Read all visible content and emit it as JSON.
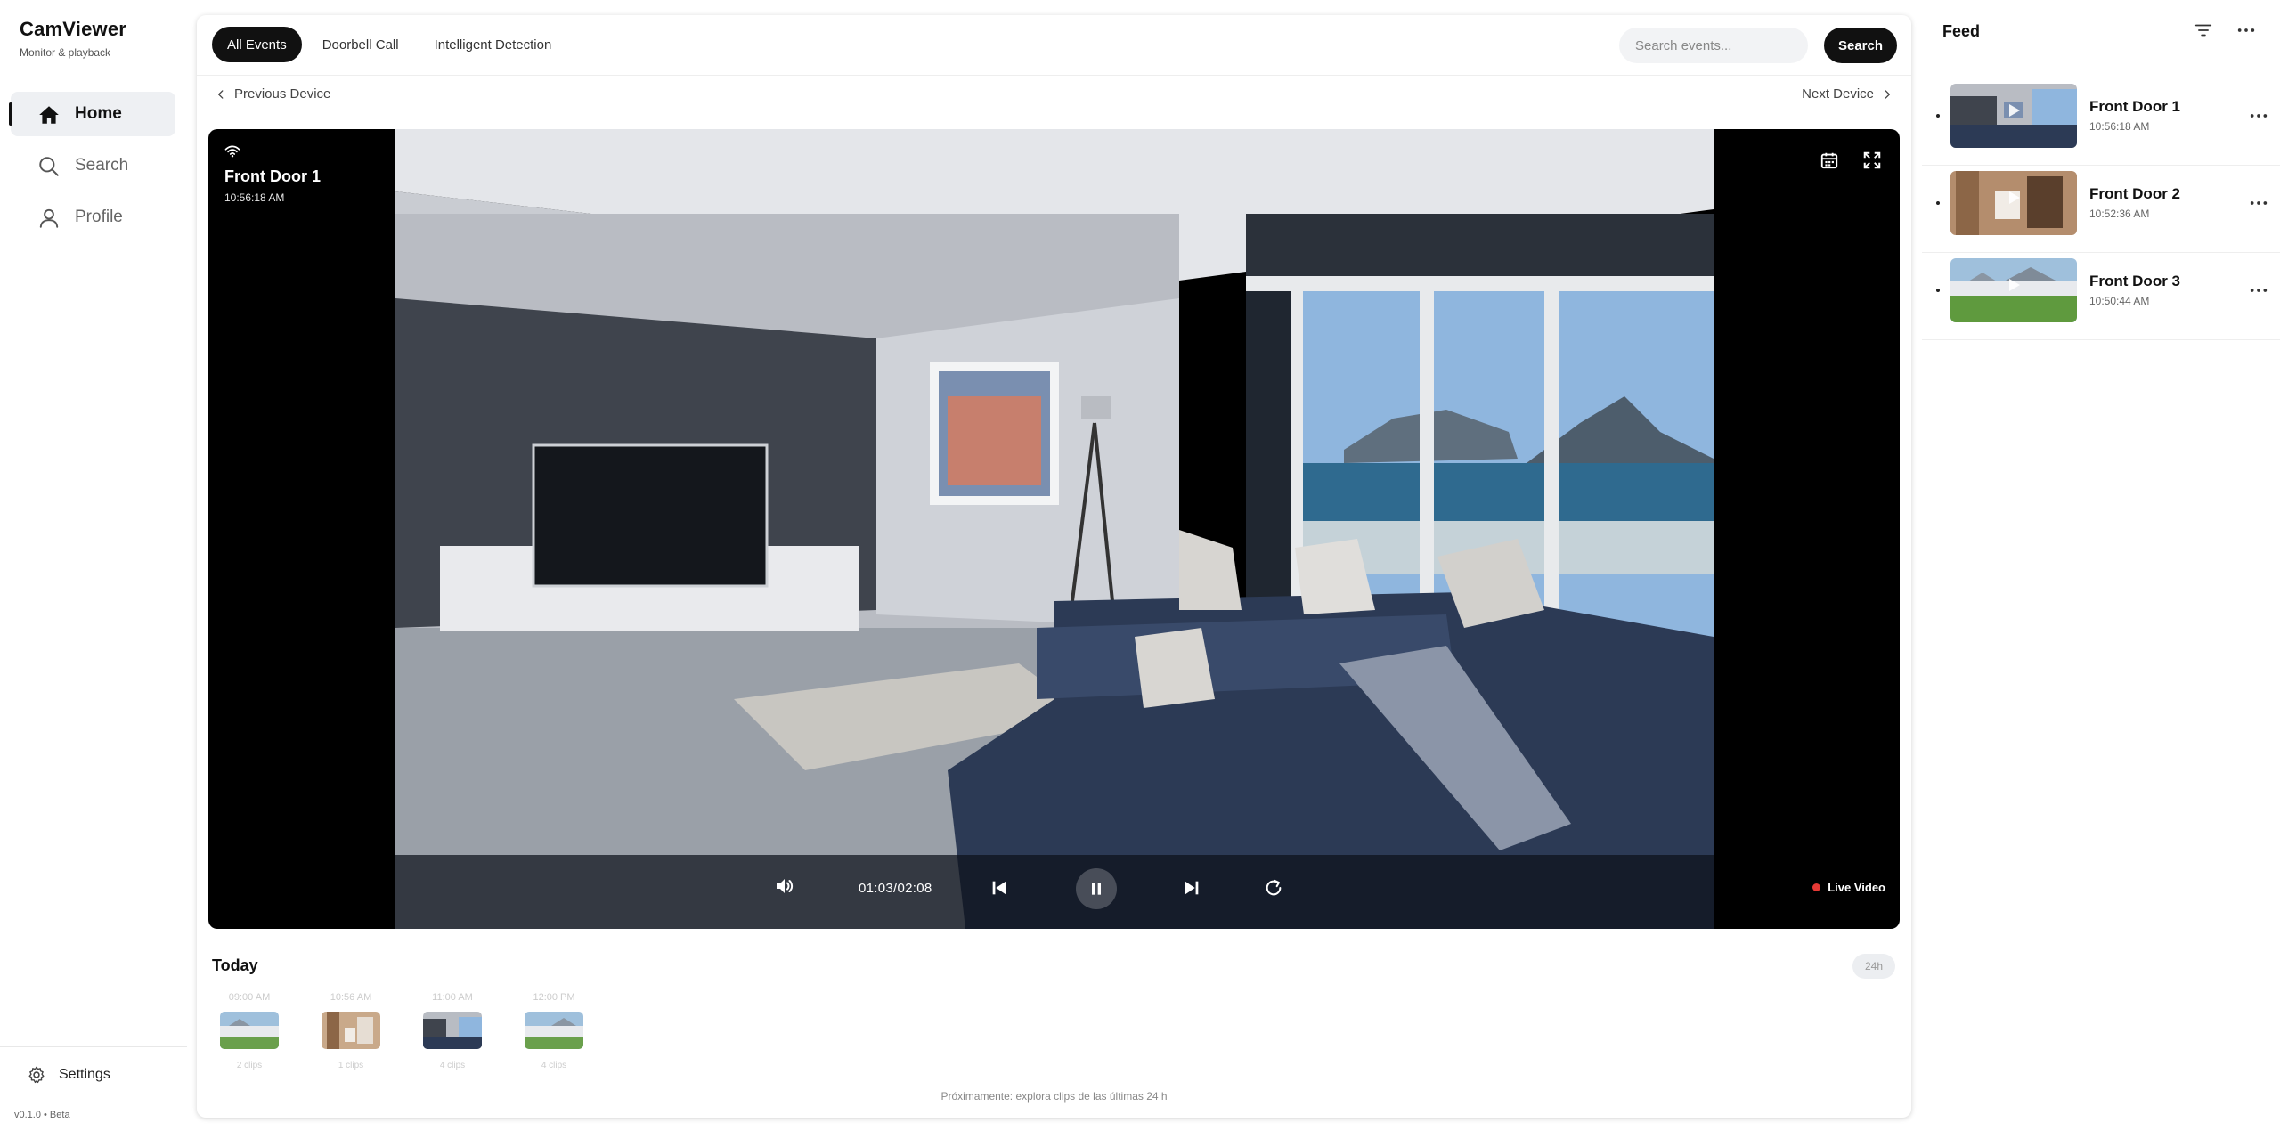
{
  "app": {
    "title": "CamViewer",
    "subtitle": "Monitor & playback",
    "version": "v0.1.0 • Beta"
  },
  "sidebar": {
    "items": [
      {
        "label": "Home",
        "icon": "home-icon",
        "active": true
      },
      {
        "label": "Search",
        "icon": "search-icon",
        "active": false
      },
      {
        "label": "Profile",
        "icon": "user-icon",
        "active": false
      }
    ],
    "settings_label": "Settings"
  },
  "tabs": [
    {
      "label": "All Events",
      "active": true
    },
    {
      "label": "Doorbell Call",
      "active": false
    },
    {
      "label": "Intelligent Detection",
      "active": false
    }
  ],
  "search": {
    "placeholder": "Search events...",
    "value": "",
    "button_label": "Search"
  },
  "device_nav": {
    "previous": "Previous Device",
    "next": "Next Device"
  },
  "player": {
    "camera_name": "Front Door 1",
    "camera_time": "10:56:18 AM",
    "timecode": "01:03/02:08",
    "live_label": "Live Video",
    "live_color": "#e53935",
    "state": "playing"
  },
  "timeline": {
    "heading": "Today",
    "range": "24h",
    "slots": [
      {
        "time": "09:00 AM",
        "count": "2 clips",
        "thumb": "garden"
      },
      {
        "time": "10:56 AM",
        "count": "1 clips",
        "thumb": "wood"
      },
      {
        "time": "11:00 AM",
        "count": "4 clips",
        "thumb": "living"
      },
      {
        "time": "12:00 PM",
        "count": "4 clips",
        "thumb": "garden"
      }
    ],
    "coming_soon": "Próximamente: explora clips de las últimas 24 h"
  },
  "feed": {
    "title": "Feed",
    "items": [
      {
        "name": "Front Door 1",
        "time": "10:56:18 AM",
        "thumb": "living"
      },
      {
        "name": "Front Door 2",
        "time": "10:52:36 AM",
        "thumb": "wood"
      },
      {
        "name": "Front Door 3",
        "time": "10:50:44 AM",
        "thumb": "garden"
      }
    ]
  },
  "colors": {
    "accent": "#111111",
    "active_nav_bg": "#eef0f3",
    "live_dot": "#e53935"
  }
}
